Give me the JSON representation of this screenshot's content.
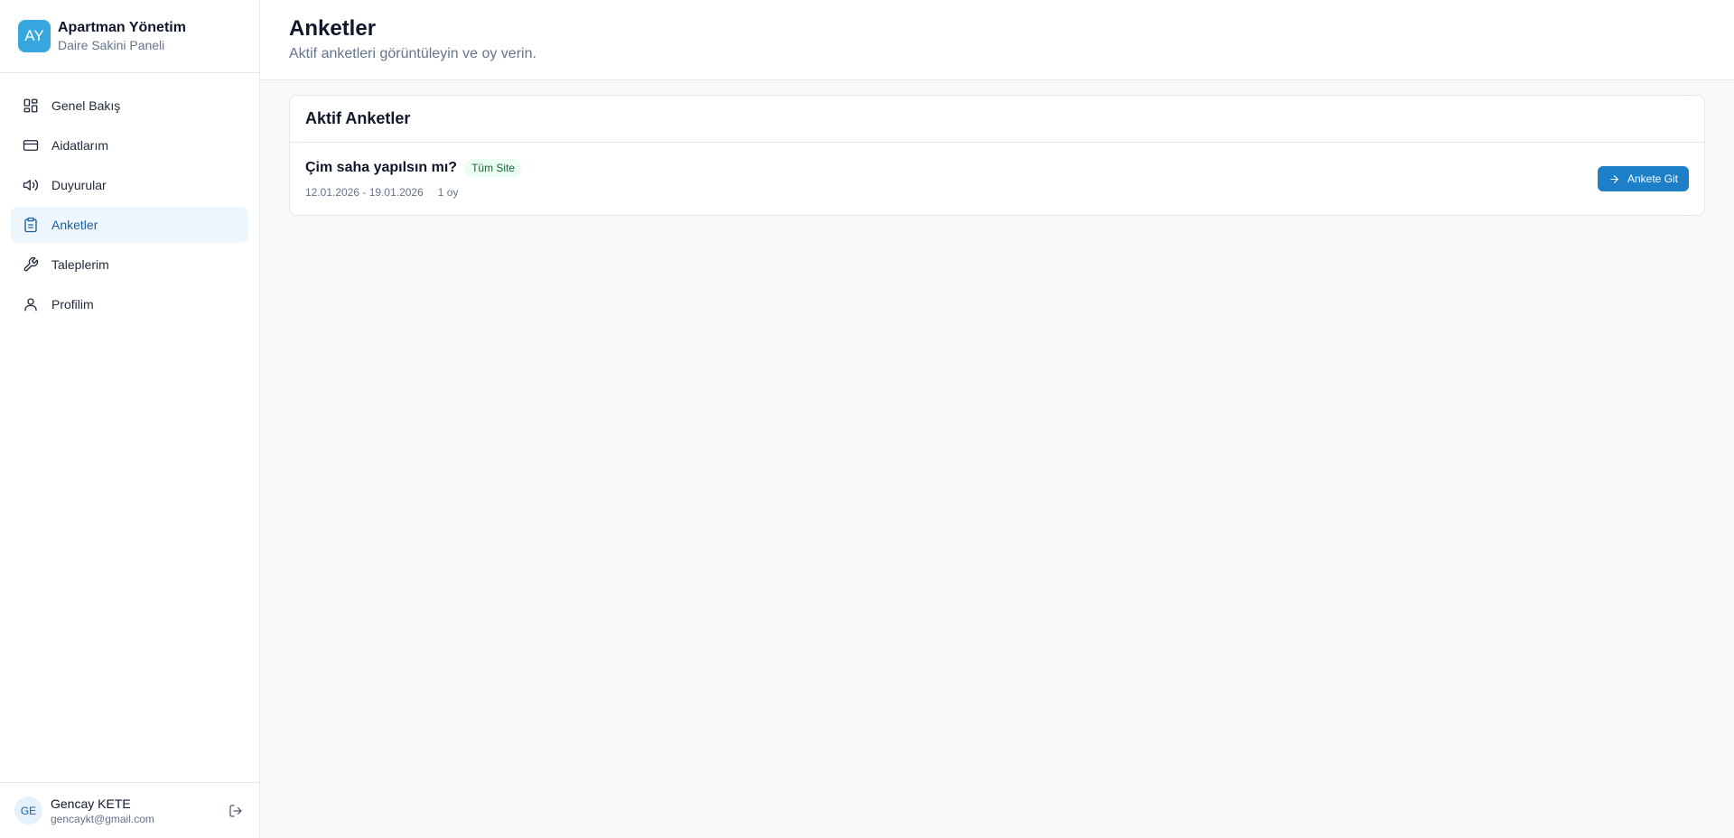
{
  "brand": {
    "logo": "AY",
    "title": "Apartman Yönetim",
    "subtitle": "Daire Sakini Paneli"
  },
  "nav": {
    "items": [
      {
        "label": "Genel Bakış",
        "icon": "dashboard-icon"
      },
      {
        "label": "Aidatlarım",
        "icon": "credit-card-icon"
      },
      {
        "label": "Duyurular",
        "icon": "megaphone-icon"
      },
      {
        "label": "Anketler",
        "icon": "clipboard-icon",
        "active": true
      },
      {
        "label": "Taleplerim",
        "icon": "wrench-icon"
      },
      {
        "label": "Profilim",
        "icon": "user-icon"
      }
    ]
  },
  "user": {
    "initials": "GE",
    "name": "Gencay KETE",
    "email": "gencaykt@gmail.com"
  },
  "page": {
    "title": "Anketler",
    "subtitle": "Aktif anketleri görüntüleyin ve oy verin."
  },
  "active_polls": {
    "title": "Aktif Anketler",
    "items": [
      {
        "title": "Çim saha yapılsın mı?",
        "badge": "Tüm Site",
        "date_range": "12.01.2026 - 19.01.2026",
        "votes": "1 oy",
        "button": "Ankete Git"
      }
    ]
  },
  "colors": {
    "accent": "#1e7fc9",
    "logo": "#38a7e0",
    "active_nav_bg": "#eef6fd",
    "badge_bg": "#ecfdf3",
    "badge_text": "#166534"
  }
}
